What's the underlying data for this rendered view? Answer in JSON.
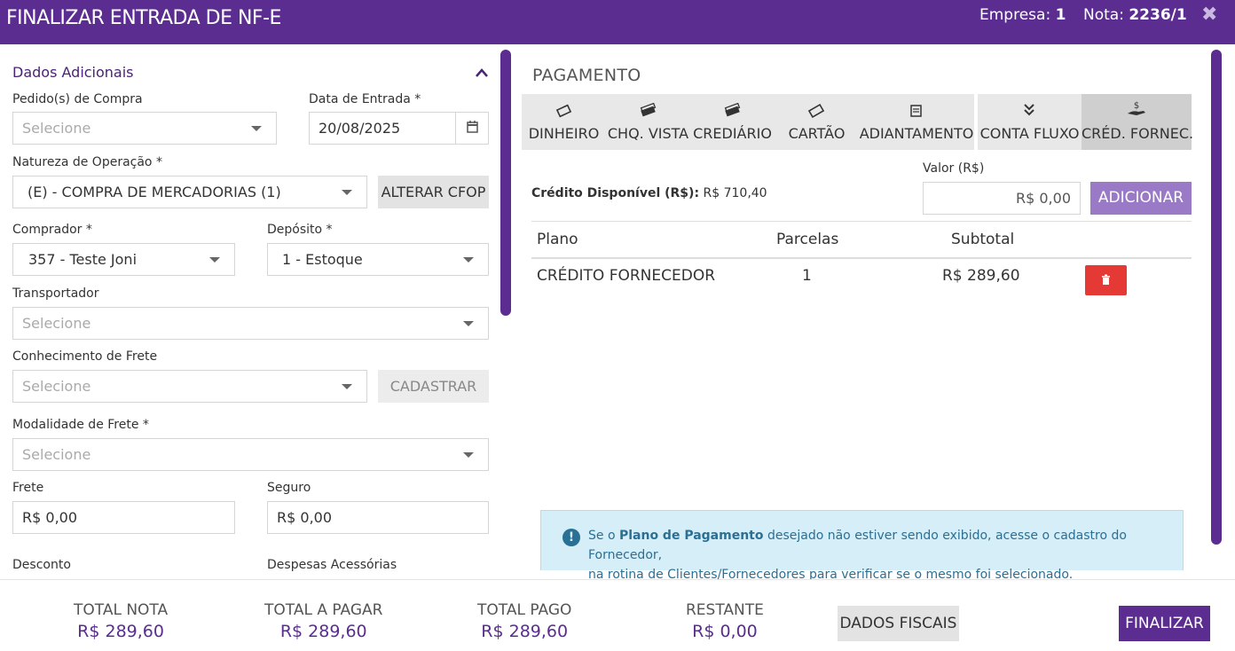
{
  "header": {
    "title": "FINALIZAR ENTRADA DE NF-E",
    "empresa_label": "Empresa:",
    "empresa_value": "1",
    "nota_label": "Nota:",
    "nota_value": "2236/1",
    "close": "✖"
  },
  "left": {
    "section_title": "Dados Adicionais",
    "pedido_label": "Pedido(s) de Compra",
    "pedido_placeholder": "Selecione",
    "data_label": "Data de Entrada *",
    "data_value": "20/08/2025",
    "natureza_label": "Natureza de Operação *",
    "natureza_value": "(E) - COMPRA DE MERCADORIAS (1)",
    "alterar_cfop": "ALTERAR CFOP",
    "comprador_label": "Comprador *",
    "comprador_value": "357 - Teste Joni",
    "deposito_label": "Depósito *",
    "deposito_value": "1 - Estoque",
    "transportador_label": "Transportador",
    "transportador_placeholder": "Selecione",
    "conhecimento_label": "Conhecimento de Frete",
    "conhecimento_placeholder": "Selecione",
    "cadastrar": "CADASTRAR",
    "modalidade_label": "Modalidade de Frete *",
    "modalidade_placeholder": "Selecione",
    "frete_label": "Frete",
    "frete_value": "R$ 0,00",
    "seguro_label": "Seguro",
    "seguro_value": "R$ 0,00",
    "desconto_label": "Desconto",
    "despesas_label": "Despesas Acessórias"
  },
  "payment": {
    "title": "PAGAMENTO",
    "tabs": [
      {
        "label": "DINHEIRO",
        "icon": "money-icon"
      },
      {
        "label": "CHQ. VISTA",
        "icon": "cheque-icon"
      },
      {
        "label": "CREDIÁRIO",
        "icon": "crediario-icon"
      },
      {
        "label": "CARTÃO",
        "icon": "card-icon"
      },
      {
        "label": "ADIANTAMENTO",
        "icon": "document-icon"
      },
      {
        "label": "CONTA FLUXO",
        "icon": "double-chevron-down-icon"
      },
      {
        "label": "CRÉD. FORNEC.",
        "icon": "hand-money-icon"
      }
    ],
    "active_tab": "CRÉD. FORNEC.",
    "credito_label": "Crédito Disponível (R$):",
    "credito_value": "R$ 710,40",
    "valor_label": "Valor (R$)",
    "valor_value": "R$ 0,00",
    "adicionar": "ADICIONAR",
    "table": {
      "headers": [
        "Plano",
        "Parcelas",
        "Subtotal"
      ],
      "rows": [
        {
          "plano": "CRÉDITO FORNECEDOR",
          "parcelas": "1",
          "subtotal": "R$ 289,60"
        }
      ]
    },
    "alert": {
      "pre": "Se o ",
      "bold": "Plano de Pagamento",
      "post": " desejado não estiver sendo exibido, acesse o cadastro do Fornecedor,",
      "line2": "na rotina de Clientes/Fornecedores para verificar se o mesmo foi selecionado."
    }
  },
  "footer": {
    "totals": [
      {
        "label": "TOTAL NOTA",
        "value": "R$ 289,60"
      },
      {
        "label": "TOTAL A PAGAR",
        "value": "R$ 289,60"
      },
      {
        "label": "TOTAL PAGO",
        "value": "R$ 289,60"
      },
      {
        "label": "RESTANTE",
        "value": "R$ 0,00"
      }
    ],
    "dados_fiscais": "DADOS FISCAIS",
    "finalizar": "FINALIZAR"
  },
  "colors": {
    "brand": "#5b2d90",
    "accent_light": "#9a79c6",
    "danger": "#e53935",
    "info_bg": "#d6eef7"
  }
}
